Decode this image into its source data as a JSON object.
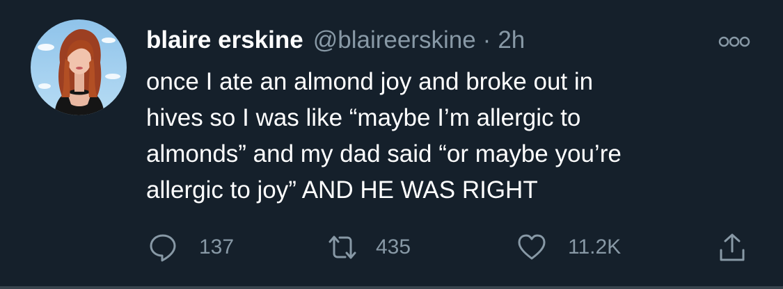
{
  "tweet": {
    "display_name": "blaire erskine",
    "handle": "@blaireerskine",
    "separator": "·",
    "time": "2h",
    "text": "once I ate an almond joy and broke out in\nhives so I was like “maybe I’m allergic to\nalmonds” and my dad said “or maybe you’re\nallergic to joy” AND HE WAS RIGHT",
    "avatar_icon": "profile-photo",
    "more_icon": "more-options-icon"
  },
  "actions": {
    "reply": {
      "icon": "reply-icon",
      "count": "137"
    },
    "retweet": {
      "icon": "retweet-icon",
      "count": "435"
    },
    "like": {
      "icon": "heart-icon",
      "count": "11.2K"
    },
    "share": {
      "icon": "share-icon"
    }
  },
  "colors": {
    "background": "#15202b",
    "primary_text": "#ffffff",
    "secondary_text": "#8899a6",
    "divider": "#38444d"
  }
}
